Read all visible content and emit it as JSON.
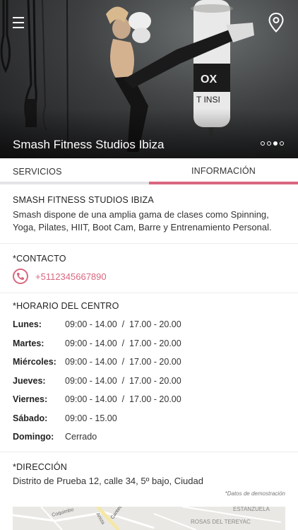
{
  "hero": {
    "title": "Smash Fitness Studios Ibiza",
    "slides_total": 4,
    "active_slide": 3,
    "bag_text": "OX",
    "bag_subtext": "T INSI"
  },
  "tabs": [
    {
      "label": "SERVICIOS",
      "active": false
    },
    {
      "label": "INFORMACIÓN",
      "active": true
    }
  ],
  "about": {
    "heading": "SMASH FITNESS STUDIOS IBIZA",
    "text": "Smash dispone de una amplia gama de clases como Spinning, Yoga, Pilates, HIIT, Boot Cam, Barre y Entrenamiento Personal."
  },
  "contact": {
    "heading": "*CONTACTO",
    "phone": "+5112345667890"
  },
  "schedule": {
    "heading": "*HORARIO DEL CENTRO",
    "rows": [
      {
        "day": "Lunes:",
        "hours": "09:00 - 14.00  /  17.00 - 20.00"
      },
      {
        "day": "Martes:",
        "hours": "09:00 - 14.00  /  17.00 - 20.00"
      },
      {
        "day": "Miércoles:",
        "hours": "09:00 - 14.00  /  17.00 - 20.00"
      },
      {
        "day": "Jueves:",
        "hours": "09:00 - 14.00  /  17.00 - 20.00"
      },
      {
        "day": "Viernes:",
        "hours": "09:00 - 14.00  /  17.00 - 20.00"
      },
      {
        "day": "Sábado:",
        "hours": "09:00 - 15.00"
      },
      {
        "day": "Domingo:",
        "hours": "Cerrado"
      }
    ]
  },
  "address": {
    "heading": "*DIRECCIÓN",
    "text": "Distrito de Prueba 12, calle 34, 5º bajo, Ciudad",
    "note": "*Datos de demostración"
  },
  "map": {
    "labels": [
      "Coquimbo",
      "Arista",
      "Cantes NIC",
      "ESTANZUELA",
      "ROSAS DEL TEREYAC"
    ]
  },
  "colors": {
    "accent": "#d9677f",
    "tab_inactive_bar": "#e3e3e8"
  }
}
